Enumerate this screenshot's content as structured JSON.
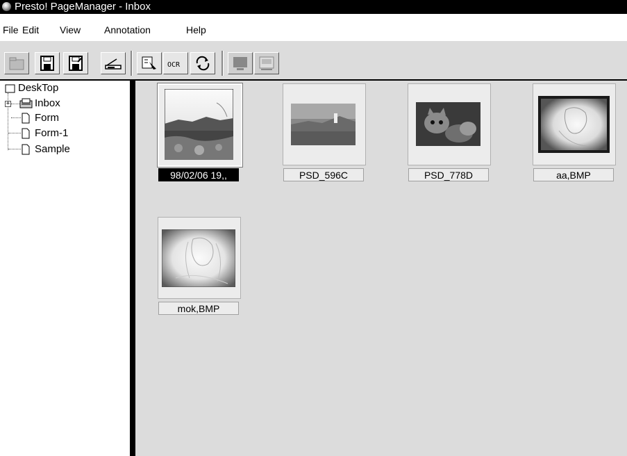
{
  "window": {
    "title": "Presto! PageManager - Inbox"
  },
  "menu": {
    "items": [
      {
        "label": "File"
      },
      {
        "label": "Edit"
      },
      {
        "label": "View"
      },
      {
        "label": "Annotation"
      },
      {
        "label": "Help"
      }
    ]
  },
  "toolbar": {
    "buttons": [
      {
        "icon": "folder-icon",
        "enabled": false
      },
      {
        "icon": "save-icon",
        "enabled": true
      },
      {
        "icon": "save-as-icon",
        "enabled": true
      },
      {
        "icon": "scanner-icon",
        "enabled": true
      },
      {
        "icon": "select-source-icon",
        "enabled": true
      },
      {
        "icon": "ocr-icon",
        "label": "OCR",
        "enabled": true
      },
      {
        "icon": "rotate-icon",
        "enabled": true
      },
      {
        "icon": "monitor-icon",
        "enabled": false
      },
      {
        "icon": "fax-icon",
        "enabled": false
      }
    ]
  },
  "tree": {
    "root": "DeskTop",
    "items": [
      {
        "label": "Inbox"
      },
      {
        "label": "Form"
      },
      {
        "label": "Form-1"
      },
      {
        "label": "Sample"
      }
    ]
  },
  "thumbnails": [
    {
      "caption": "98/02/06 19,,",
      "selected": true,
      "image": "landscape-photo"
    },
    {
      "caption": "PSD_596C",
      "selected": false,
      "image": "village-photo"
    },
    {
      "caption": "PSD_778D",
      "selected": false,
      "image": "kitten-photo"
    },
    {
      "caption": "aa,BMP",
      "selected": false,
      "image": "portrait-drawing"
    },
    {
      "caption": "mok,BMP",
      "selected": false,
      "image": "portrait-drawing-2"
    }
  ]
}
